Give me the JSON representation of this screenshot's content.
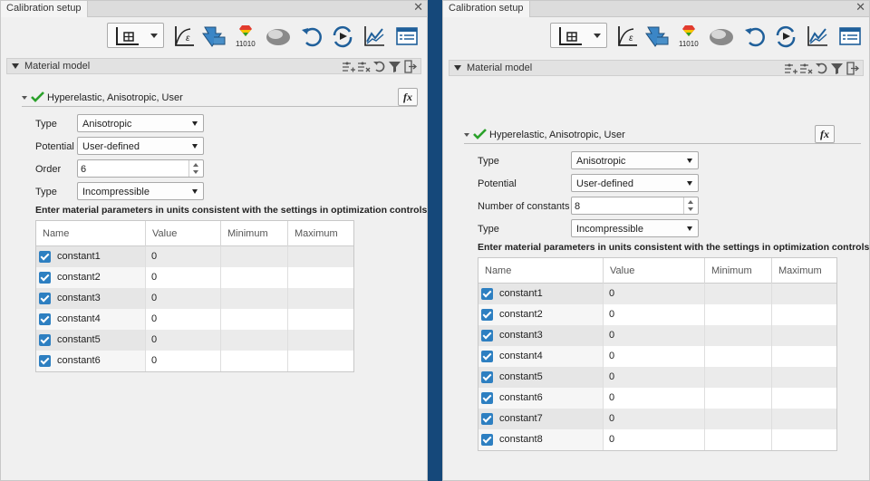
{
  "left_panel": {
    "tab_title": "Calibration setup",
    "section_title": "Material model",
    "model_title": "Hyperelastic, Anisotropic, User",
    "fx_label": "fx",
    "fields": {
      "type1_label": "Type",
      "type1_value": "Anisotropic",
      "potential_label": "Potential",
      "potential_value": "User-defined",
      "order_label": "Order",
      "order_value": "6",
      "type2_label": "Type",
      "type2_value": "Incompressible"
    },
    "instruction": "Enter material parameters in units consistent with the settings in optimization controls",
    "table": {
      "headers": [
        "Name",
        "Value",
        "Minimum",
        "Maximum"
      ],
      "rows": [
        {
          "name": "constant1",
          "value": "0"
        },
        {
          "name": "constant2",
          "value": "0"
        },
        {
          "name": "constant3",
          "value": "0"
        },
        {
          "name": "constant4",
          "value": "0"
        },
        {
          "name": "constant5",
          "value": "0"
        },
        {
          "name": "constant6",
          "value": "0"
        }
      ]
    }
  },
  "right_panel": {
    "tab_title": "Calibration setup",
    "section_title": "Material model",
    "model_title": "Hyperelastic, Anisotropic, User",
    "fx_label": "fx",
    "fields": {
      "type1_label": "Type",
      "type1_value": "Anisotropic",
      "potential_label": "Potential",
      "potential_value": "User-defined",
      "count_label": "Number of constants",
      "count_value": "8",
      "type2_label": "Type",
      "type2_value": "Incompressible"
    },
    "instruction": "Enter material parameters in units consistent with the settings in optimization controls",
    "table": {
      "headers": [
        "Name",
        "Value",
        "Minimum",
        "Maximum"
      ],
      "rows": [
        {
          "name": "constant1",
          "value": "0"
        },
        {
          "name": "constant2",
          "value": "0"
        },
        {
          "name": "constant3",
          "value": "0"
        },
        {
          "name": "constant4",
          "value": "0"
        },
        {
          "name": "constant5",
          "value": "0"
        },
        {
          "name": "constant6",
          "value": "0"
        },
        {
          "name": "constant7",
          "value": "0"
        },
        {
          "name": "constant8",
          "value": "0"
        }
      ]
    }
  },
  "toolbar_icons": [
    "plot-combo-icon",
    "strain-curve-icon",
    "import-arrow-icon",
    "binary-data-icon",
    "solid-shape-icon",
    "undo-icon",
    "run-refresh-icon",
    "line-chart-icon",
    "settings-panel-icon"
  ],
  "section_icons": [
    "add-filter-icon",
    "remove-filter-icon",
    "reset-icon",
    "funnel-icon",
    "export-icon"
  ],
  "colors": {
    "background": "#15487a",
    "accent": "#2d7fc1",
    "check": "#2aa12a"
  }
}
